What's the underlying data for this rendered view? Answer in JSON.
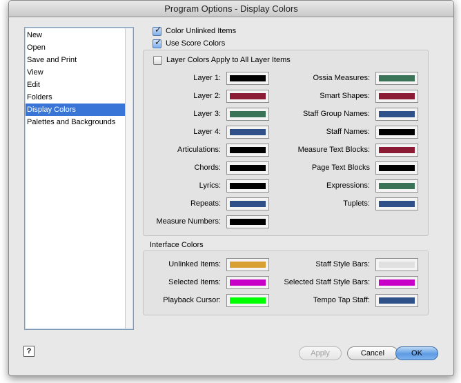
{
  "window": {
    "title": "Program Options - Display Colors"
  },
  "sidebar": {
    "items": [
      {
        "label": "New",
        "selected": false
      },
      {
        "label": "Open",
        "selected": false
      },
      {
        "label": "Save and Print",
        "selected": false
      },
      {
        "label": "View",
        "selected": false
      },
      {
        "label": "Edit",
        "selected": false
      },
      {
        "label": "Folders",
        "selected": false
      },
      {
        "label": "Display Colors",
        "selected": true
      },
      {
        "label": "Palettes and Backgrounds",
        "selected": false
      }
    ]
  },
  "options": {
    "color_unlinked": {
      "label": "Color Unlinked Items",
      "checked": true
    },
    "use_score_colors": {
      "label": "Use Score Colors",
      "checked": true
    },
    "layer_colors_all": {
      "label": "Layer Colors Apply to All Layer Items",
      "checked": false
    }
  },
  "score_colors": {
    "left": [
      {
        "label": "Layer 1:",
        "color": "#000000"
      },
      {
        "label": "Layer 2:",
        "color": "#8b1a35"
      },
      {
        "label": "Layer 3:",
        "color": "#3a7358"
      },
      {
        "label": "Layer 4:",
        "color": "#2e5189"
      },
      {
        "label": "Articulations:",
        "color": "#000000"
      },
      {
        "label": "Chords:",
        "color": "#000000"
      },
      {
        "label": "Lyrics:",
        "color": "#000000"
      },
      {
        "label": "Repeats:",
        "color": "#2e5189"
      },
      {
        "label": "Measure Numbers:",
        "color": "#000000"
      }
    ],
    "right": [
      {
        "label": "Ossia Measures:",
        "color": "#3a7358"
      },
      {
        "label": "Smart Shapes:",
        "color": "#8b1a35"
      },
      {
        "label": "Staff Group Names:",
        "color": "#2e5189"
      },
      {
        "label": "Staff Names:",
        "color": "#000000"
      },
      {
        "label": "Measure Text Blocks:",
        "color": "#8b1a35"
      },
      {
        "label": "Page Text Blocks",
        "color": "#000000"
      },
      {
        "label": "Expressions:",
        "color": "#3a7358"
      },
      {
        "label": "Tuplets:",
        "color": "#2e5189"
      }
    ]
  },
  "interface_colors": {
    "title": "Interface Colors",
    "left": [
      {
        "label": "Unlinked Items:",
        "color": "#d8a030"
      },
      {
        "label": "Selected Items:",
        "color": "#c800c8"
      },
      {
        "label": "Playback Cursor:",
        "color": "#00ff00"
      }
    ],
    "right": [
      {
        "label": "Staff Style Bars:",
        "color": "#e0e0e0"
      },
      {
        "label": "Selected Staff Style Bars:",
        "color": "#c800c8"
      },
      {
        "label": "Tempo Tap Staff:",
        "color": "#2e5189"
      }
    ]
  },
  "buttons": {
    "help": "?",
    "apply": "Apply",
    "cancel": "Cancel",
    "ok": "OK"
  }
}
